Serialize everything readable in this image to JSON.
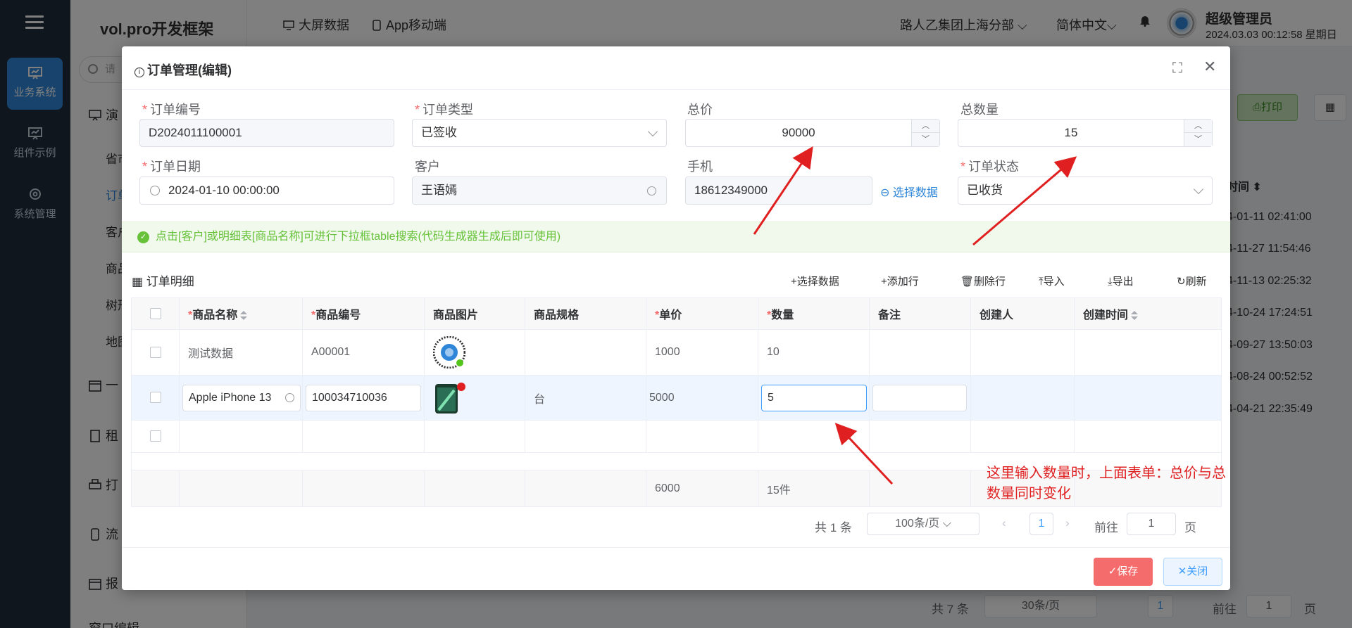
{
  "rail": {
    "items": [
      {
        "label": "业务系统",
        "active": true
      },
      {
        "label": "组件示例",
        "active": false
      },
      {
        "label": "系统管理",
        "active": false
      }
    ]
  },
  "sidebar": {
    "brand": "vol.pro开发框架",
    "search_placeholder": "请",
    "groups": [
      {
        "label": "演"
      },
      {
        "label": "一"
      },
      {
        "label": "租"
      },
      {
        "label": "打"
      },
      {
        "label": "流"
      },
      {
        "label": "报"
      },
      {
        "label": "窗口编辑"
      }
    ],
    "subitems": [
      {
        "label": "省市"
      },
      {
        "label": "订单"
      },
      {
        "label": "客户"
      },
      {
        "label": "商品"
      },
      {
        "label": "树形"
      },
      {
        "label": "地图"
      }
    ]
  },
  "header": {
    "bigscreen": "大屏数据",
    "app": "App移动端",
    "org": "路人乙集团上海分部",
    "lang": "简体中文",
    "user_name": "超级管理员",
    "datetime": "2024.03.03 00:12:58 星期日"
  },
  "background": {
    "print_btn": "打印",
    "time_header": "时间",
    "times": [
      "4-01-11 02:41:00",
      "4-11-27 11:54:46",
      "4-11-13 02:25:32",
      "4-10-24 17:24:51",
      "4-09-27 13:50:03",
      "4-08-24 00:52:52",
      "4-04-21 22:35:49"
    ],
    "total": "共 7 条",
    "page_size": "30条/页",
    "page": "1",
    "goto_prefix": "前往",
    "goto_value": "1",
    "goto_suffix": "页"
  },
  "dialog": {
    "title": "订单管理(编辑)",
    "fields": {
      "order_no": {
        "label": "订单编号",
        "value": "D2024011100001"
      },
      "order_type": {
        "label": "订单类型",
        "value": "已签收"
      },
      "total_price": {
        "label": "总价",
        "value": "90000"
      },
      "total_qty": {
        "label": "总数量",
        "value": "15"
      },
      "order_date": {
        "label": "订单日期",
        "value": "2024-01-10 00:00:00"
      },
      "customer": {
        "label": "客户",
        "value": "王语嫣"
      },
      "phone": {
        "label": "手机",
        "value": "18612349000"
      },
      "pick_data": "选择数据",
      "order_status": {
        "label": "订单状态",
        "value": "已收货"
      }
    },
    "tip": "点击[客户]或明细表[商品名称]可进行下拉框table搜索(代码生成器生成后即可使用)",
    "detail_title": "订单明细",
    "toolbar": {
      "select": "选择数据",
      "add": "添加行",
      "delete": "删除行",
      "import": "导入",
      "export": "导出",
      "refresh": "刷新"
    },
    "columns": [
      "商品名称",
      "商品编号",
      "商品图片",
      "商品规格",
      "单价",
      "数量",
      "备注",
      "创建人",
      "创建时间"
    ],
    "rows": [
      {
        "name": "测试数据",
        "code": "A00001",
        "spec": "",
        "price": "1000",
        "qty": "10",
        "remark": "",
        "creator": "",
        "created": ""
      },
      {
        "name": "Apple iPhone 13",
        "code": "100034710036",
        "spec": "台",
        "price": "5000",
        "qty": "5",
        "remark": "",
        "creator": "",
        "created": ""
      }
    ],
    "summary": {
      "price": "6000",
      "qty": "15件"
    },
    "pager": {
      "total": "共 1 条",
      "page_size": "100条/页",
      "page": "1",
      "goto_prefix": "前往",
      "goto_value": "1",
      "goto_suffix": "页"
    },
    "save": "保存",
    "close": "关闭",
    "annotation": "这里输入数量时，上面表单：总价与总数量同时变化"
  }
}
